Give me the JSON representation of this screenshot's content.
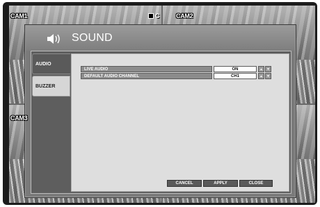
{
  "cameras": [
    "CAM1",
    "CAM2",
    "CAM3"
  ],
  "rec_indicator": "C",
  "dialog": {
    "title": "SOUND",
    "icon": "speaker-icon",
    "tabs": [
      {
        "label": "AUDIO",
        "active": true
      },
      {
        "label": "BUZZER",
        "active": false
      }
    ],
    "settings": [
      {
        "label": "LIVE AUDIO",
        "value": "ON"
      },
      {
        "label": "DEFAULT AUDIO CHANNEL",
        "value": "CH1"
      }
    ],
    "buttons": {
      "cancel": "CANCEL",
      "apply": "APPLY",
      "close": "CLOSE"
    }
  },
  "colors": {
    "dialog_bg": "#7a7a7a",
    "content_bg": "#dedede",
    "button_bg": "#5a5a5a"
  }
}
